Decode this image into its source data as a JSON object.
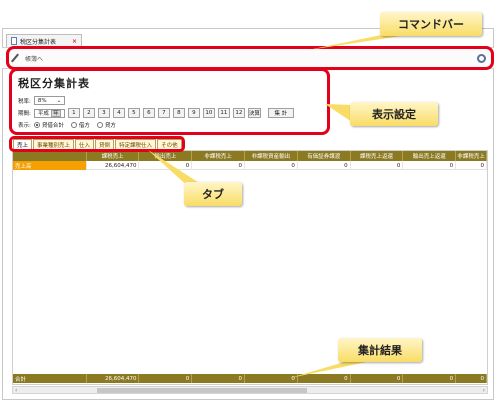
{
  "document_tab": {
    "title": "税区分集計表",
    "close": "×"
  },
  "command_bar": {
    "placeholder": "帳簿へ"
  },
  "settings": {
    "title": "税区分集計表",
    "tax_rate_label": "税率:",
    "tax_rate_value": "8%",
    "period_label": "期間:",
    "era_value": "平成",
    "year_suffix": "年",
    "months": [
      "1",
      "2",
      "3",
      "4",
      "5",
      "6",
      "7",
      "8",
      "9",
      "10",
      "11",
      "12"
    ],
    "settle_label": "決算",
    "aggregate_button": "集 計",
    "display_label": "表示:",
    "radios": [
      {
        "label": "貸借合計",
        "checked": true
      },
      {
        "label": "借方",
        "checked": false
      },
      {
        "label": "貸方",
        "checked": false
      }
    ]
  },
  "tabs": [
    "売上",
    "事業種別売上",
    "仕入",
    "貸倒",
    "特定課税仕入",
    "その他"
  ],
  "grid": {
    "columns": [
      "",
      "課税売上",
      "輸出売上",
      "非課税売上",
      "非課税資産輸出",
      "有価証券譲渡",
      "課税売上返還",
      "輸出売上返還",
      "非課税売上"
    ],
    "row": {
      "label": "売上高",
      "values": [
        "26,604,470",
        "0",
        "0",
        "0",
        "0",
        "0",
        "0",
        "0"
      ]
    },
    "total": {
      "label": "合計",
      "values": [
        "26,604,470",
        "0",
        "0",
        "0",
        "0",
        "0",
        "0",
        "0"
      ]
    }
  },
  "annotations": {
    "command_bar": "コマンドバー",
    "settings": "表示設定",
    "tabs": "タブ",
    "results": "集計結果"
  },
  "colors": {
    "accent_red": "#e3001b",
    "header_olive": "#8b7a22",
    "row_orange": "#f59f00",
    "callout_yellow": "#f9dc66"
  }
}
